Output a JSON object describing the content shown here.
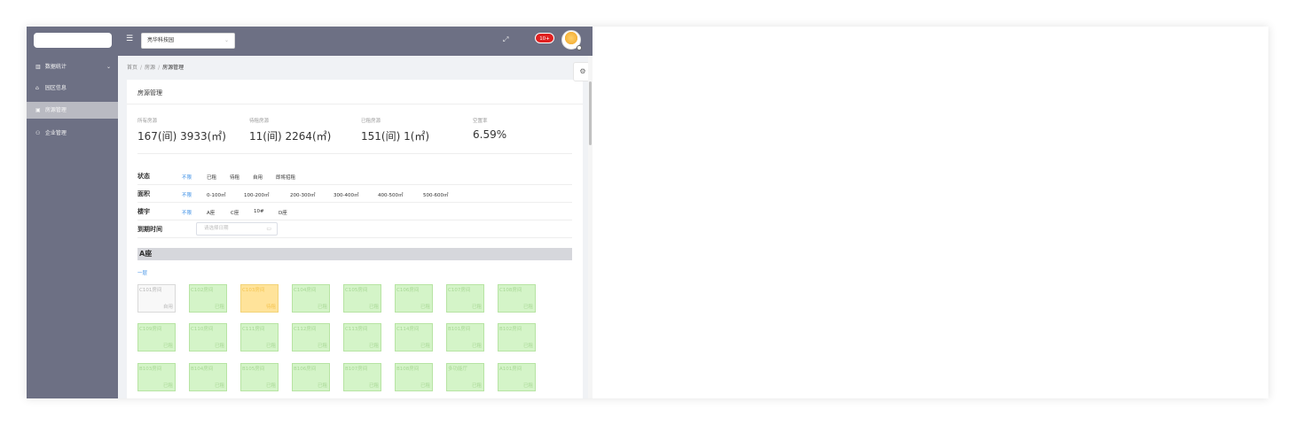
{
  "topbar": {
    "park_select": "亮华科技园",
    "notification_badge": "10+"
  },
  "sidebar": {
    "items": [
      {
        "label": "数据统计",
        "icon": "bar-chart-icon",
        "chevron": "⌄"
      },
      {
        "label": "园区信息",
        "icon": "home-icon"
      },
      {
        "label": "房源管理",
        "icon": "house-icon",
        "active": true
      },
      {
        "label": "企业管理",
        "icon": "people-icon"
      }
    ]
  },
  "breadcrumb": [
    "首页",
    "房源",
    "房源管理"
  ],
  "panel": {
    "title": "房源管理"
  },
  "stats": [
    {
      "label": "所有房源",
      "value": "167(间) 3933(㎡)"
    },
    {
      "label": "待租房源",
      "value": "11(间) 2264(㎡)"
    },
    {
      "label": "已租房源",
      "value": "151(间) 1(㎡)"
    },
    {
      "label": "空置率",
      "value": "6.59%"
    }
  ],
  "filters": {
    "status": {
      "label": "状态",
      "options": [
        "不限",
        "已租",
        "待租",
        "自用",
        "即将招租"
      ]
    },
    "area": {
      "label": "面积",
      "options": [
        "不限",
        "0-100㎡",
        "100-200㎡",
        "200-300㎡",
        "300-400㎡",
        "400-500㎡",
        "500-600㎡"
      ]
    },
    "building": {
      "label": "楼宇",
      "options": [
        "不限",
        "A座",
        "C座",
        "10#",
        "D座"
      ]
    },
    "expiry": {
      "label": "到期时间",
      "placeholder": "请选择日期"
    }
  },
  "building": {
    "name": "A座",
    "floor": "一层",
    "rooms": [
      {
        "name": "C101房间",
        "status": "自用",
        "type": "selfuse"
      },
      {
        "name": "C102房间",
        "status": "已租",
        "type": "rented"
      },
      {
        "name": "C103房间",
        "status": "待租",
        "type": "torent"
      },
      {
        "name": "C104房间",
        "status": "已租",
        "type": "rented"
      },
      {
        "name": "C105房间",
        "status": "已租",
        "type": "rented"
      },
      {
        "name": "C106房间",
        "status": "已租",
        "type": "rented"
      },
      {
        "name": "C107房间",
        "status": "已租",
        "type": "rented"
      },
      {
        "name": "C108房间",
        "status": "已租",
        "type": "rented"
      },
      {
        "name": "C109房间",
        "status": "已租",
        "type": "rented"
      },
      {
        "name": "C110房间",
        "status": "已租",
        "type": "rented"
      },
      {
        "name": "C111房间",
        "status": "已租",
        "type": "rented"
      },
      {
        "name": "C112房间",
        "status": "已租",
        "type": "rented"
      },
      {
        "name": "C113房间",
        "status": "已租",
        "type": "rented"
      },
      {
        "name": "C114房间",
        "status": "已租",
        "type": "rented"
      },
      {
        "name": "B101房间",
        "status": "已租",
        "type": "rented"
      },
      {
        "name": "B102房间",
        "status": "已租",
        "type": "rented"
      },
      {
        "name": "B103房间",
        "status": "已租",
        "type": "rented"
      },
      {
        "name": "B104房间",
        "status": "已租",
        "type": "rented"
      },
      {
        "name": "B105房间",
        "status": "已租",
        "type": "rented"
      },
      {
        "name": "B106房间",
        "status": "已租",
        "type": "rented"
      },
      {
        "name": "B107房间",
        "status": "已租",
        "type": "rented"
      },
      {
        "name": "B108房间",
        "status": "已租",
        "type": "rented"
      },
      {
        "name": "多功能厅",
        "status": "已租",
        "type": "rented"
      },
      {
        "name": "A101房间",
        "status": "已租",
        "type": "rented"
      }
    ]
  },
  "colors": {
    "sidebar_bg": "#6d7084",
    "accent": "#3a8ee6",
    "rented": "#d4f4c8",
    "to_rent": "#ffe39a",
    "self_use": "#f8f8f8",
    "badge": "#e02020"
  }
}
